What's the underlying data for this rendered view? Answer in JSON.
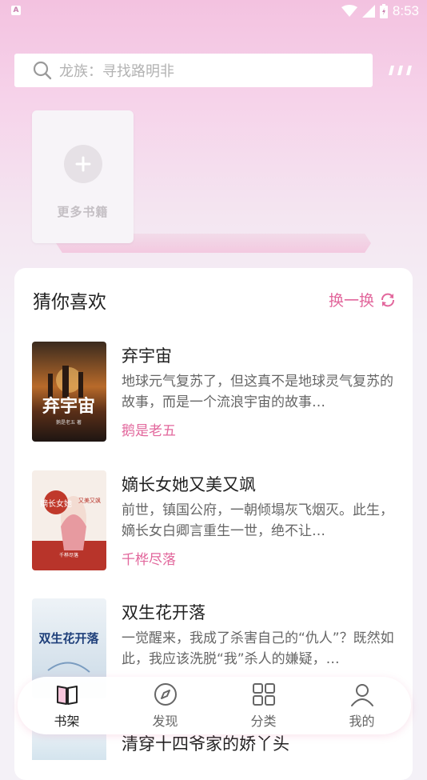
{
  "status_bar": {
    "time": "8:53",
    "left_icon": "A"
  },
  "search": {
    "placeholder": "龙族：寻找路明非"
  },
  "shelf": {
    "more_books_label": "更多书籍"
  },
  "recommend": {
    "title": "猜你喜欢",
    "swap_label": "换一换",
    "books": [
      {
        "title": "弃宇宙",
        "desc": "地球元气复苏了，但这真不是地球灵气复苏的故事，而是一个流浪宇宙的故事…",
        "author": "鹅是老五",
        "cover_text": "弃宇宙",
        "cover_sub": "鹅是老五 著"
      },
      {
        "title": "嫡长女她又美又飒",
        "desc": "前世，镇国公府，一朝倾塌灰飞烟灭。此生，嫡长女白卿言重生一世，绝不让…",
        "author": "千桦尽落",
        "cover_text": "嫡长女她",
        "cover_sub": "又美又飒",
        "cover_author": "千桦尽落"
      },
      {
        "title": "双生花开落",
        "desc": "一觉醒来，我成了杀害自己的“仇人”？既然如此，我应该洗脱“我”杀人的嫌疑，…",
        "author": "",
        "cover_text": "双生花开落"
      }
    ],
    "peek_title": "清穿十四爷家的娇丫头"
  },
  "tabs": [
    {
      "label": "书架",
      "icon": "book-icon",
      "active": true
    },
    {
      "label": "发现",
      "icon": "compass-icon",
      "active": false
    },
    {
      "label": "分类",
      "icon": "grid-icon",
      "active": false
    },
    {
      "label": "我的",
      "icon": "user-icon",
      "active": false
    }
  ],
  "colors": {
    "accent": "#e2679c",
    "header_gradient_top": "#f3c2e0"
  }
}
